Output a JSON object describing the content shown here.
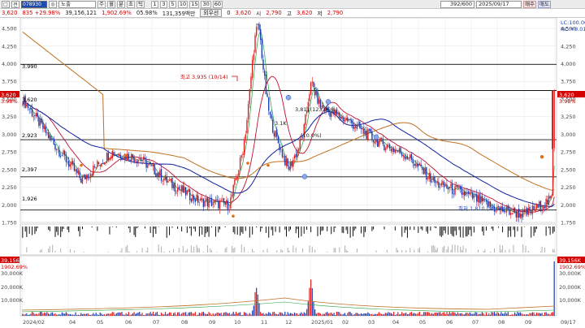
{
  "toolbar": {
    "items_a": [
      "□",
      "전"
    ],
    "code": "078930",
    "item_field": "노출",
    "period_buttons": [
      "주",
      "월",
      "분",
      "초",
      "틱",
      "1",
      "3",
      "5",
      "10",
      "15",
      "30",
      "60"
    ],
    "count": "392/600",
    "date": "2025/09/17",
    "sell_label": "매수",
    "buy_label": "매도"
  },
  "info": {
    "price": "3,620",
    "change": "835 +29.98%",
    "volume": "39,156,121",
    "volume_ratio": "1,902.69%",
    "turnover": "05.98%",
    "amount": "131,359백만",
    "preferred_label": "외우선",
    "zero": "0",
    "open_value": "3,620",
    "open_label": "시",
    "open_price": "2,790",
    "high_label": "고",
    "high_price": "3,620",
    "low_label": "저",
    "low_price": "2,790"
  },
  "price_panel": {
    "y_ticks_left": [
      "4,500",
      "4,250",
      "4,000",
      "3,750",
      "3,500",
      "3,250",
      "3,000",
      "2,750",
      "2,500",
      "2,250",
      "2,000",
      "1,750"
    ],
    "y_ticks_right": [
      "4,500",
      "4,250",
      "4,000",
      "3,750",
      "3,500",
      "3,250",
      "3,000",
      "2,750",
      "2,500",
      "2,250",
      "2,000",
      "1,750"
    ],
    "levels": [
      "3,990",
      "3,620",
      "2,923",
      "2,397",
      "1,926"
    ],
    "current_badge": "3,620",
    "current_pct": "3.98%",
    "lc_hc": [
      "LC:100.00",
      "HC:+8.01"
    ],
    "high_annotation": "최고 3,935 (10/14)",
    "low_annotation": "최저 1,810 (08/20)",
    "mid_annotation": "3,811(123.96%)",
    "mid_annotation2": "(10.0%)",
    "mid_left_annotation": "3.1K"
  },
  "volume_panel": {
    "badge_value": "39,156K",
    "badge_pct": "1902.69%",
    "y_ticks": [
      "30,000K",
      "20,000K",
      "10,000K"
    ],
    "y_ticks_left": [
      "30,000K",
      "20,000K",
      "10,000K"
    ]
  },
  "x_axis": {
    "labels": [
      "2024/02",
      "04",
      "05",
      "06",
      "07",
      "08",
      "09",
      "10",
      "11",
      "12",
      "2025/01",
      "02",
      "03",
      "04",
      "05",
      "06",
      "07",
      "08",
      "09",
      "09/17"
    ]
  },
  "chart_data": {
    "type": "candlestick",
    "title": "",
    "series": [
      {
        "name": "3,620",
        "values": [
          3620
        ]
      }
    ],
    "y_range": [
      1750,
      4500
    ],
    "levels": [
      3990,
      3620,
      2923,
      2397,
      1926
    ],
    "x": [
      "2024/02",
      "04",
      "05",
      "06",
      "07",
      "08",
      "09",
      "10",
      "11",
      "12",
      "2025/01",
      "02",
      "03",
      "04",
      "05",
      "06",
      "07",
      "08",
      "09"
    ],
    "close_approx": [
      3500,
      2900,
      2350,
      2750,
      2650,
      2300,
      2050,
      2000,
      3600,
      2500,
      3400,
      3200,
      2900,
      2700,
      2300,
      2150,
      1950,
      1860,
      2100
    ]
  }
}
